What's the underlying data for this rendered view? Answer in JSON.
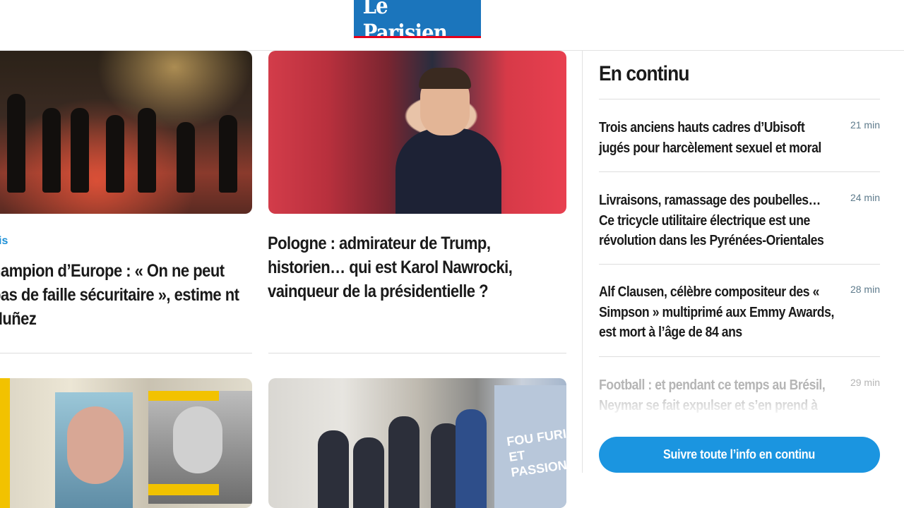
{
  "header": {
    "logo_text": "Le Parisien",
    "logo_color": "#1b75bc",
    "logo_accent": "#e3001b"
  },
  "main": {
    "cards": [
      {
        "kicker": "is",
        "headline": "hampion d’Europe : « On ne peut pas de faille sécuritaire », estime nt Nuñez"
      },
      {
        "headline": "Pologne : admirateur de Trump, historien… qui est Karol Nawrocki, vainqueur de la présidentielle ?"
      }
    ],
    "poster_text": "FOU FURIEUX ET PASSIONNANT"
  },
  "sidebar": {
    "title": "En continu",
    "items": [
      {
        "title": "Trois anciens hauts cadres d’Ubisoft jugés pour harcèlement sexuel et moral",
        "time": "21 min"
      },
      {
        "title": "Livraisons, ramassage des poubelles… Ce tricycle utilitaire électrique est une révolution dans les Pyrénées-Orientales",
        "time": "24 min"
      },
      {
        "title": "Alf Clausen, célèbre compositeur des « Simpson » multiprimé aux Emmy Awards, est mort à l’âge de 84 ans",
        "time": "28 min"
      },
      {
        "title": "Football : et pendant ce temps au Brésil, Neymar se fait expulser et s’en prend à",
        "time": "29 min"
      }
    ],
    "button_label": "Suivre toute l’info en continu",
    "accent_color": "#1b95e0"
  }
}
